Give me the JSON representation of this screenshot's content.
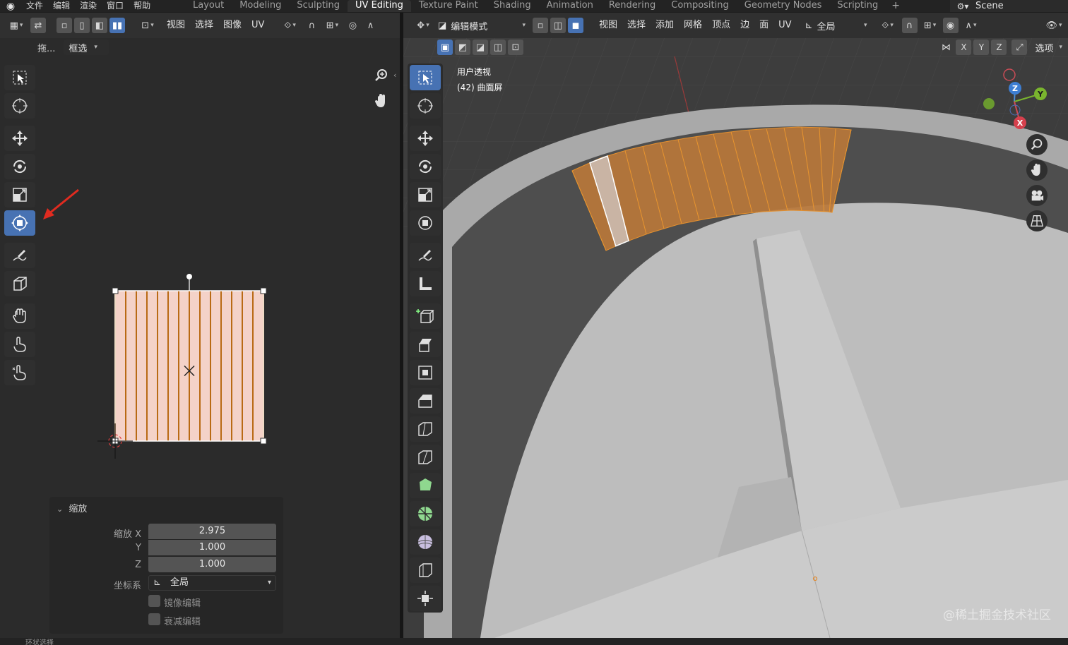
{
  "topbar": {
    "menus": [
      "文件",
      "编辑",
      "渲染",
      "窗口",
      "帮助"
    ],
    "workspaces": [
      "Layout",
      "Modeling",
      "Sculpting",
      "UV Editing",
      "Texture Paint",
      "Shading",
      "Animation",
      "Rendering",
      "Compositing",
      "Geometry Nodes",
      "Scripting"
    ],
    "active_workspace": "UV Editing",
    "scene_label": "Scene"
  },
  "uv_editor": {
    "menus": [
      "视图",
      "选择",
      "图像",
      "UV"
    ],
    "drag_label": "拖...",
    "select_mode": "框选"
  },
  "viewport": {
    "mode": "编辑模式",
    "menus": [
      "视图",
      "选择",
      "添加",
      "网格",
      "顶点",
      "边",
      "面",
      "UV"
    ],
    "transform_orientation": "全局",
    "axis_x": "X",
    "axis_y": "Y",
    "axis_z": "Z",
    "options_label": "选项",
    "view_name": "用户透视",
    "object_name": "(42) 曲面屏",
    "gizmo_z": "Z",
    "gizmo_y": "Y",
    "gizmo_x": "X"
  },
  "redo_panel": {
    "title": "缩放",
    "scale_x_label": "缩放 X",
    "scale_x": "2.975",
    "scale_y_label": "Y",
    "scale_y": "1.000",
    "scale_z_label": "Z",
    "scale_z": "1.000",
    "orientation_label": "坐标系",
    "orientation_value": "全局",
    "mirror_label": "镜像编辑",
    "falloff_label": "衰减编辑"
  },
  "status_text": "环状选择",
  "watermark": "@稀土掘金技术社区",
  "colors": {
    "accent": "#4772b3",
    "uv_face": "#f4d2c8",
    "uv_edge": "#b96a14",
    "mesh_selected": "#b8773a"
  }
}
